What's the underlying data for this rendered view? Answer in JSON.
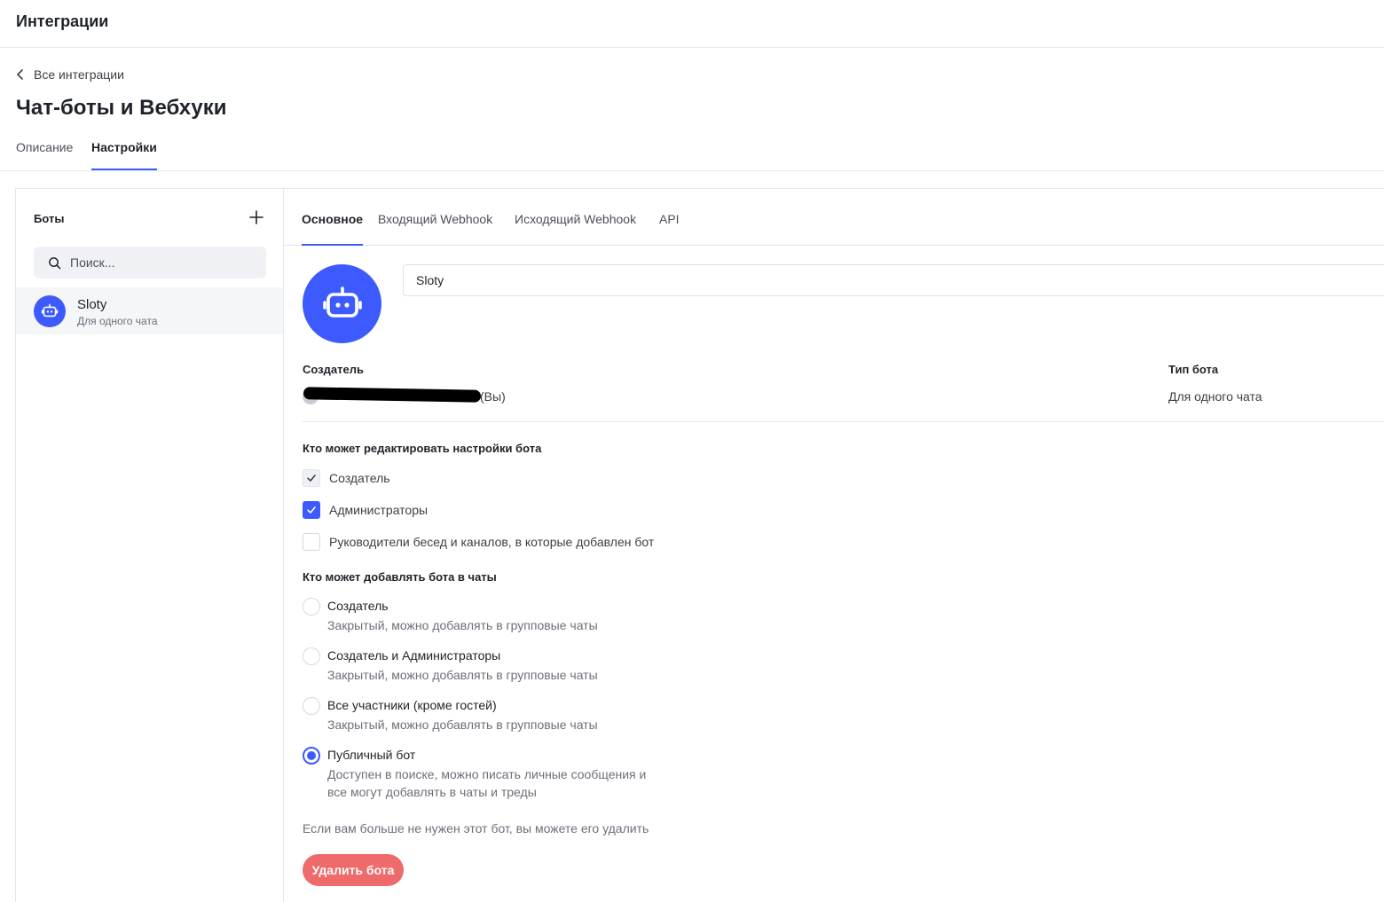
{
  "header": {
    "title": "Интеграции"
  },
  "breadcrumb": {
    "back_label": "Все интеграции"
  },
  "page": {
    "title": "Чат-боты и Вебхуки"
  },
  "top_tabs": [
    {
      "label": "Описание",
      "active": false
    },
    {
      "label": "Настройки",
      "active": true
    }
  ],
  "sidebar": {
    "title": "Боты",
    "search_placeholder": "Поиск...",
    "items": [
      {
        "name": "Sloty",
        "subtitle": "Для одного чата",
        "selected": true
      }
    ]
  },
  "inner_tabs": [
    {
      "label": "Основное",
      "active": true
    },
    {
      "label": "Входящий Webhook",
      "active": false
    },
    {
      "label": "Исходящий Webhook",
      "active": false
    },
    {
      "label": "API",
      "active": false
    }
  ],
  "bot": {
    "name_value": "Sloty",
    "creator_label": "Создатель",
    "creator_suffix": "(Вы)",
    "type_label": "Тип бота",
    "type_value": "Для одного чата"
  },
  "edit_permissions": {
    "title": "Кто может редактировать настройки бота",
    "options": [
      {
        "label": "Создатель",
        "checked": true,
        "disabled": true
      },
      {
        "label": "Администраторы",
        "checked": true,
        "disabled": false
      },
      {
        "label": "Руководители бесед и каналов, в которые добавлен бот",
        "checked": false,
        "disabled": false
      }
    ]
  },
  "add_permissions": {
    "title": "Кто может добавлять бота в чаты",
    "options": [
      {
        "label": "Создатель",
        "description": "Закрытый, можно добавлять в групповые чаты",
        "selected": false
      },
      {
        "label": "Создатель и Администраторы",
        "description": "Закрытый, можно добавлять в групповые чаты",
        "selected": false
      },
      {
        "label": "Все участники (кроме гостей)",
        "description": "Закрытый, можно добавлять в групповые чаты",
        "selected": false
      },
      {
        "label": "Публичный бот",
        "description": "Доступен в поиске, можно писать личные сообщения и все могут добавлять в чаты и треды",
        "selected": true
      }
    ]
  },
  "delete": {
    "hint": "Если вам больше не нужен этот бот, вы можете его удалить",
    "button_label": "Удалить бота"
  },
  "colors": {
    "accent": "#3d5afe",
    "danger": "#ef6a6a"
  }
}
